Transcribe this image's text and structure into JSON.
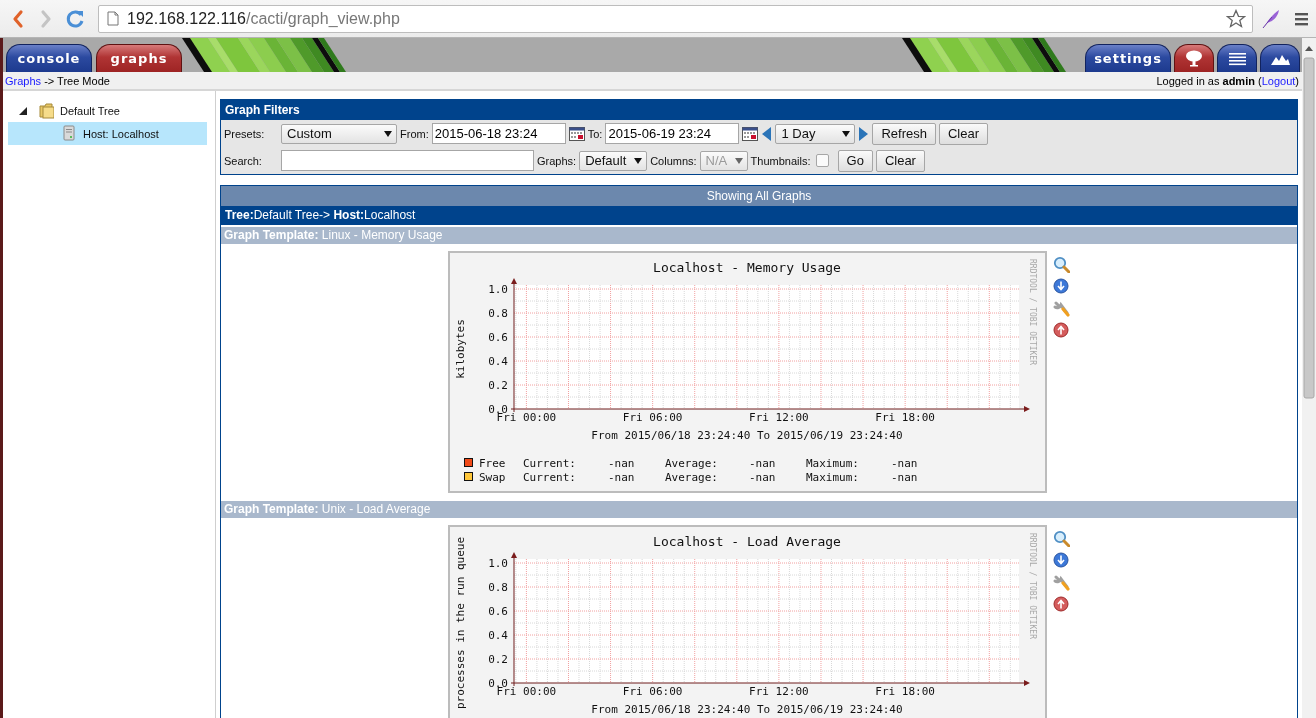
{
  "browser": {
    "url_host": "192.168.122.116",
    "url_path": "/cacti/graph_view.php"
  },
  "header": {
    "tabs": [
      {
        "label": "console",
        "selected": false
      },
      {
        "label": "graphs",
        "selected": true
      }
    ],
    "settings_tab": {
      "label": "settings",
      "selected": false
    },
    "view_tabs": [
      {
        "kind": "tree",
        "selected": true
      },
      {
        "kind": "list",
        "selected": false
      },
      {
        "kind": "preview",
        "selected": false
      }
    ]
  },
  "breadcrumb": {
    "link": "Graphs",
    "text": " -> Tree Mode"
  },
  "login": {
    "before": "Logged in as **admin** (",
    "link": "Logout",
    "after": ")"
  },
  "tree": [
    {
      "label": "Default Tree",
      "kind": "folder",
      "expanded": true,
      "selected": false,
      "children": [
        {
          "label": "Host: Localhost",
          "kind": "host",
          "selected": true
        }
      ]
    }
  ],
  "filters": {
    "title": "Graph Filters",
    "time_row": [
      {
        "kind": "label",
        "text": "Presets:"
      },
      {
        "kind": "select",
        "value": "Custom",
        "disabled": false
      },
      {
        "kind": "label",
        "text": "From:"
      },
      {
        "kind": "input",
        "value": "2015-06-18 23:24"
      },
      {
        "kind": "calendar"
      },
      {
        "kind": "label",
        "text": "To:"
      },
      {
        "kind": "input",
        "value": "2015-06-19 23:24"
      },
      {
        "kind": "calendar"
      },
      {
        "kind": "arrow-left"
      },
      {
        "kind": "select",
        "value": "1 Day",
        "disabled": false
      },
      {
        "kind": "arrow-right"
      },
      {
        "kind": "button",
        "text": "Refresh"
      },
      {
        "kind": "button",
        "text": "Clear"
      }
    ],
    "search_row": [
      {
        "kind": "label",
        "text": "Search:"
      },
      {
        "kind": "input"
      },
      {
        "kind": "label",
        "text": "Graphs:"
      },
      {
        "kind": "select",
        "value": "Default",
        "disabled": false
      },
      {
        "kind": "label",
        "text": "Columns:"
      },
      {
        "kind": "select",
        "value": "N/A",
        "disabled": true
      },
      {
        "kind": "label",
        "text": "Thumbnails:"
      },
      {
        "kind": "checkbox",
        "checked": false
      },
      {
        "kind": "button",
        "text": "Go"
      },
      {
        "kind": "button",
        "text": "Clear"
      }
    ]
  },
  "graphs_title": "Showing All Graphs",
  "tree_path": "**Tree:**Default Tree-> **Host:**Localhost",
  "templates": [
    {
      "heading": "**Graph Template:** Linux - Memory Usage",
      "graph": {
        "credit": "RRDTOOL / TOBI OETIKER",
        "period": "From 2015/06/18 23:24:40 To 2015/06/19 23:24:40",
        "chart_data": {
          "type": "line",
          "title": "Localhost - Memory Usage",
          "ylabel": "kilobytes",
          "grid": true,
          "ylim": [
            0,
            1
          ],
          "categories": [
            "Fri 00:00",
            "Fri 06:00",
            "Fri 12:00",
            "Fri 18:00"
          ],
          "yticks": [
            {
              "value": 0,
              "label": "0.0"
            },
            {
              "value": 0.2,
              "label": "0.2"
            },
            {
              "value": 0.4,
              "label": "0.4"
            },
            {
              "value": 0.6,
              "label": "0.6"
            },
            {
              "value": 0.8,
              "label": "0.8"
            },
            {
              "value": 1,
              "label": "1.0"
            }
          ],
          "series": [
            {
              "name": "Free",
              "color": "#f04a18",
              "values": [
                null,
                null,
                null,
                null
              ]
            },
            {
              "name": "Swap",
              "color": "#ffc73b",
              "values": [
                null,
                null,
                null,
                null
              ]
            }
          ]
        },
        "legend": [
          {
            "stats": [
              {
                "label": "Current:",
                "value": "-nan"
              },
              {
                "label": "Average:",
                "value": "-nan"
              },
              {
                "label": "Maximum:",
                "value": "-nan"
              }
            ]
          },
          {
            "stats": [
              {
                "label": "Current:",
                "value": "-nan"
              },
              {
                "label": "Average:",
                "value": "-nan"
              },
              {
                "label": "Maximum:",
                "value": "-nan"
              }
            ]
          }
        ]
      }
    },
    {
      "heading": "**Graph Template:** Unix - Load Average",
      "graph": {
        "credit": "RRDTOOL / TOBI OETIKER",
        "period": "From 2015/06/18 23:24:40 To 2015/06/19 23:24:40",
        "chart_data": {
          "type": "line",
          "title": "Localhost - Load Average",
          "ylabel": "processes in the run queue",
          "grid": true,
          "ylim": [
            0,
            1
          ],
          "categories": [
            "Fri 00:00",
            "Fri 06:00",
            "Fri 12:00",
            "Fri 18:00"
          ],
          "yticks": [
            {
              "value": 0,
              "label": "0.0"
            },
            {
              "value": 0.2,
              "label": "0.2"
            },
            {
              "value": 0.4,
              "label": "0.4"
            },
            {
              "value": 0.6,
              "label": "0.6"
            },
            {
              "value": 0.8,
              "label": "0.8"
            },
            {
              "value": 1,
              "label": "1.0"
            }
          ]
        }
      }
    }
  ]
}
